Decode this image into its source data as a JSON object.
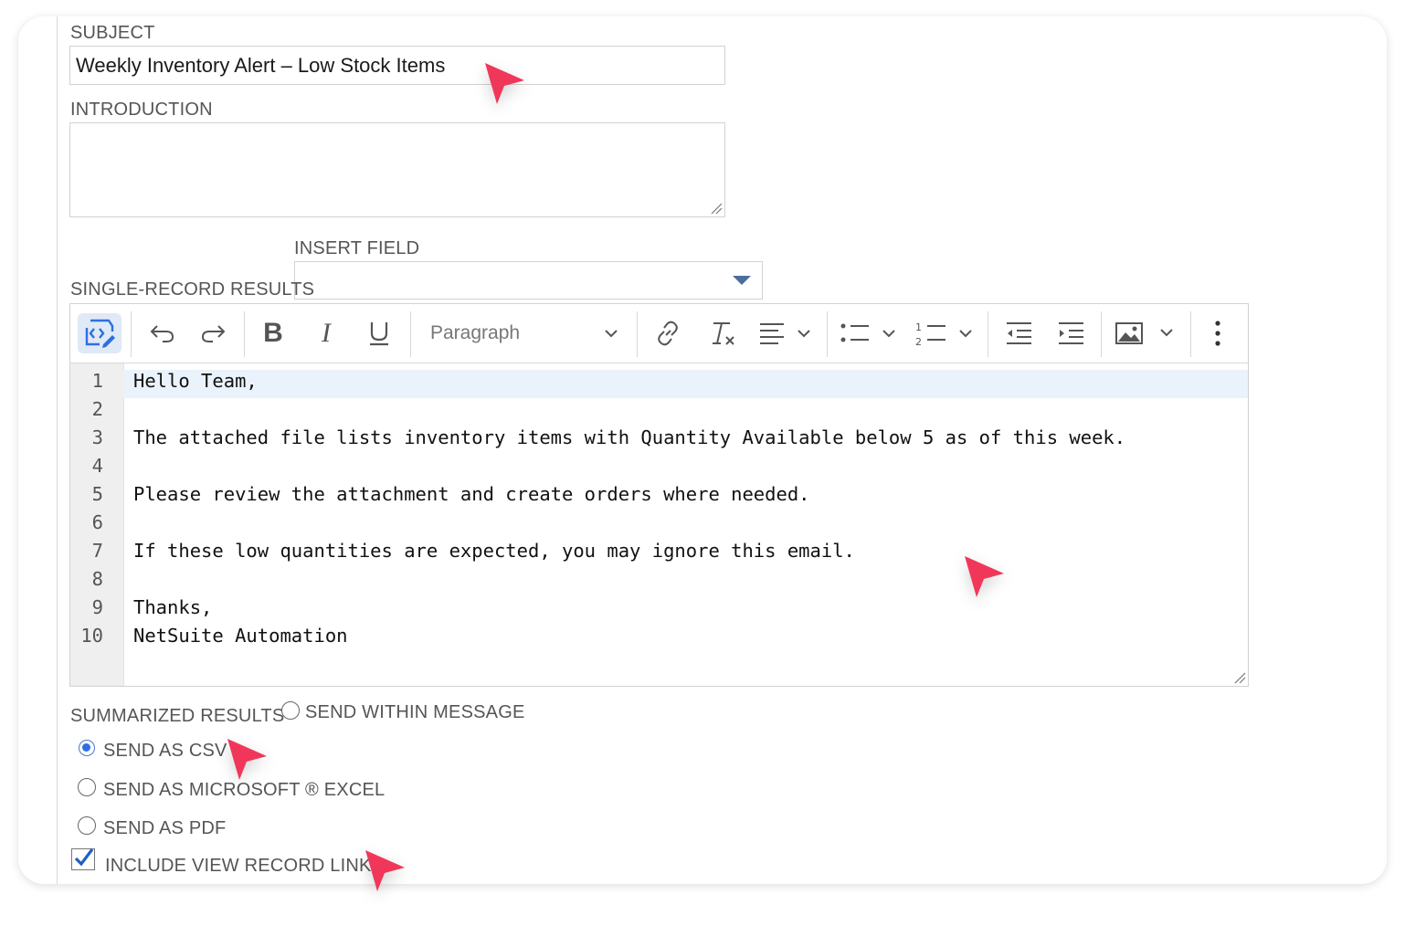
{
  "subject": {
    "label": "SUBJECT",
    "value": "Weekly Inventory Alert – Low Stock Items"
  },
  "introduction": {
    "label": "INTRODUCTION",
    "value": ""
  },
  "insert_field": {
    "label": "INSERT FIELD",
    "value": ""
  },
  "single_record": {
    "label": "SINGLE-RECORD RESULTS"
  },
  "toolbar": {
    "icons": [
      "code-view-icon",
      "undo-icon",
      "redo-icon",
      "bold-icon",
      "italic-icon",
      "underline-icon",
      "link-icon",
      "clear-format-icon",
      "align-icon",
      "bullet-list-icon",
      "numbered-list-icon",
      "outdent-icon",
      "indent-icon",
      "image-icon",
      "more-icon"
    ],
    "paragraph_select": "Paragraph"
  },
  "editor": {
    "lines": [
      {
        "n": "1",
        "text": "Hello Team,"
      },
      {
        "n": "2",
        "text": ""
      },
      {
        "n": "3",
        "text": "The attached file lists inventory items with Quantity Available below 5 as of this week."
      },
      {
        "n": "4",
        "text": ""
      },
      {
        "n": "5",
        "text": "Please review the attachment and create orders where needed."
      },
      {
        "n": "6",
        "text": ""
      },
      {
        "n": "7",
        "text": "If these low quantities are expected, you may ignore this email."
      },
      {
        "n": "8",
        "text": ""
      },
      {
        "n": "9",
        "text": "Thanks,"
      },
      {
        "n": "10",
        "text": "NetSuite Automation"
      }
    ]
  },
  "summarized": {
    "label": "SUMMARIZED RESULTS",
    "options": [
      {
        "label": "SEND WITHIN MESSAGE",
        "selected": false
      },
      {
        "label": "SEND AS CSV",
        "selected": true
      },
      {
        "label": "SEND AS MICROSOFT ® EXCEL",
        "selected": false
      },
      {
        "label": "SEND AS PDF",
        "selected": false
      }
    ]
  },
  "include_link": {
    "label": "INCLUDE VIEW RECORD LINK",
    "checked": true
  },
  "colors": {
    "accent": "#2e6fe0",
    "cursor": "#f0375a",
    "check": "#1f5fbf"
  }
}
